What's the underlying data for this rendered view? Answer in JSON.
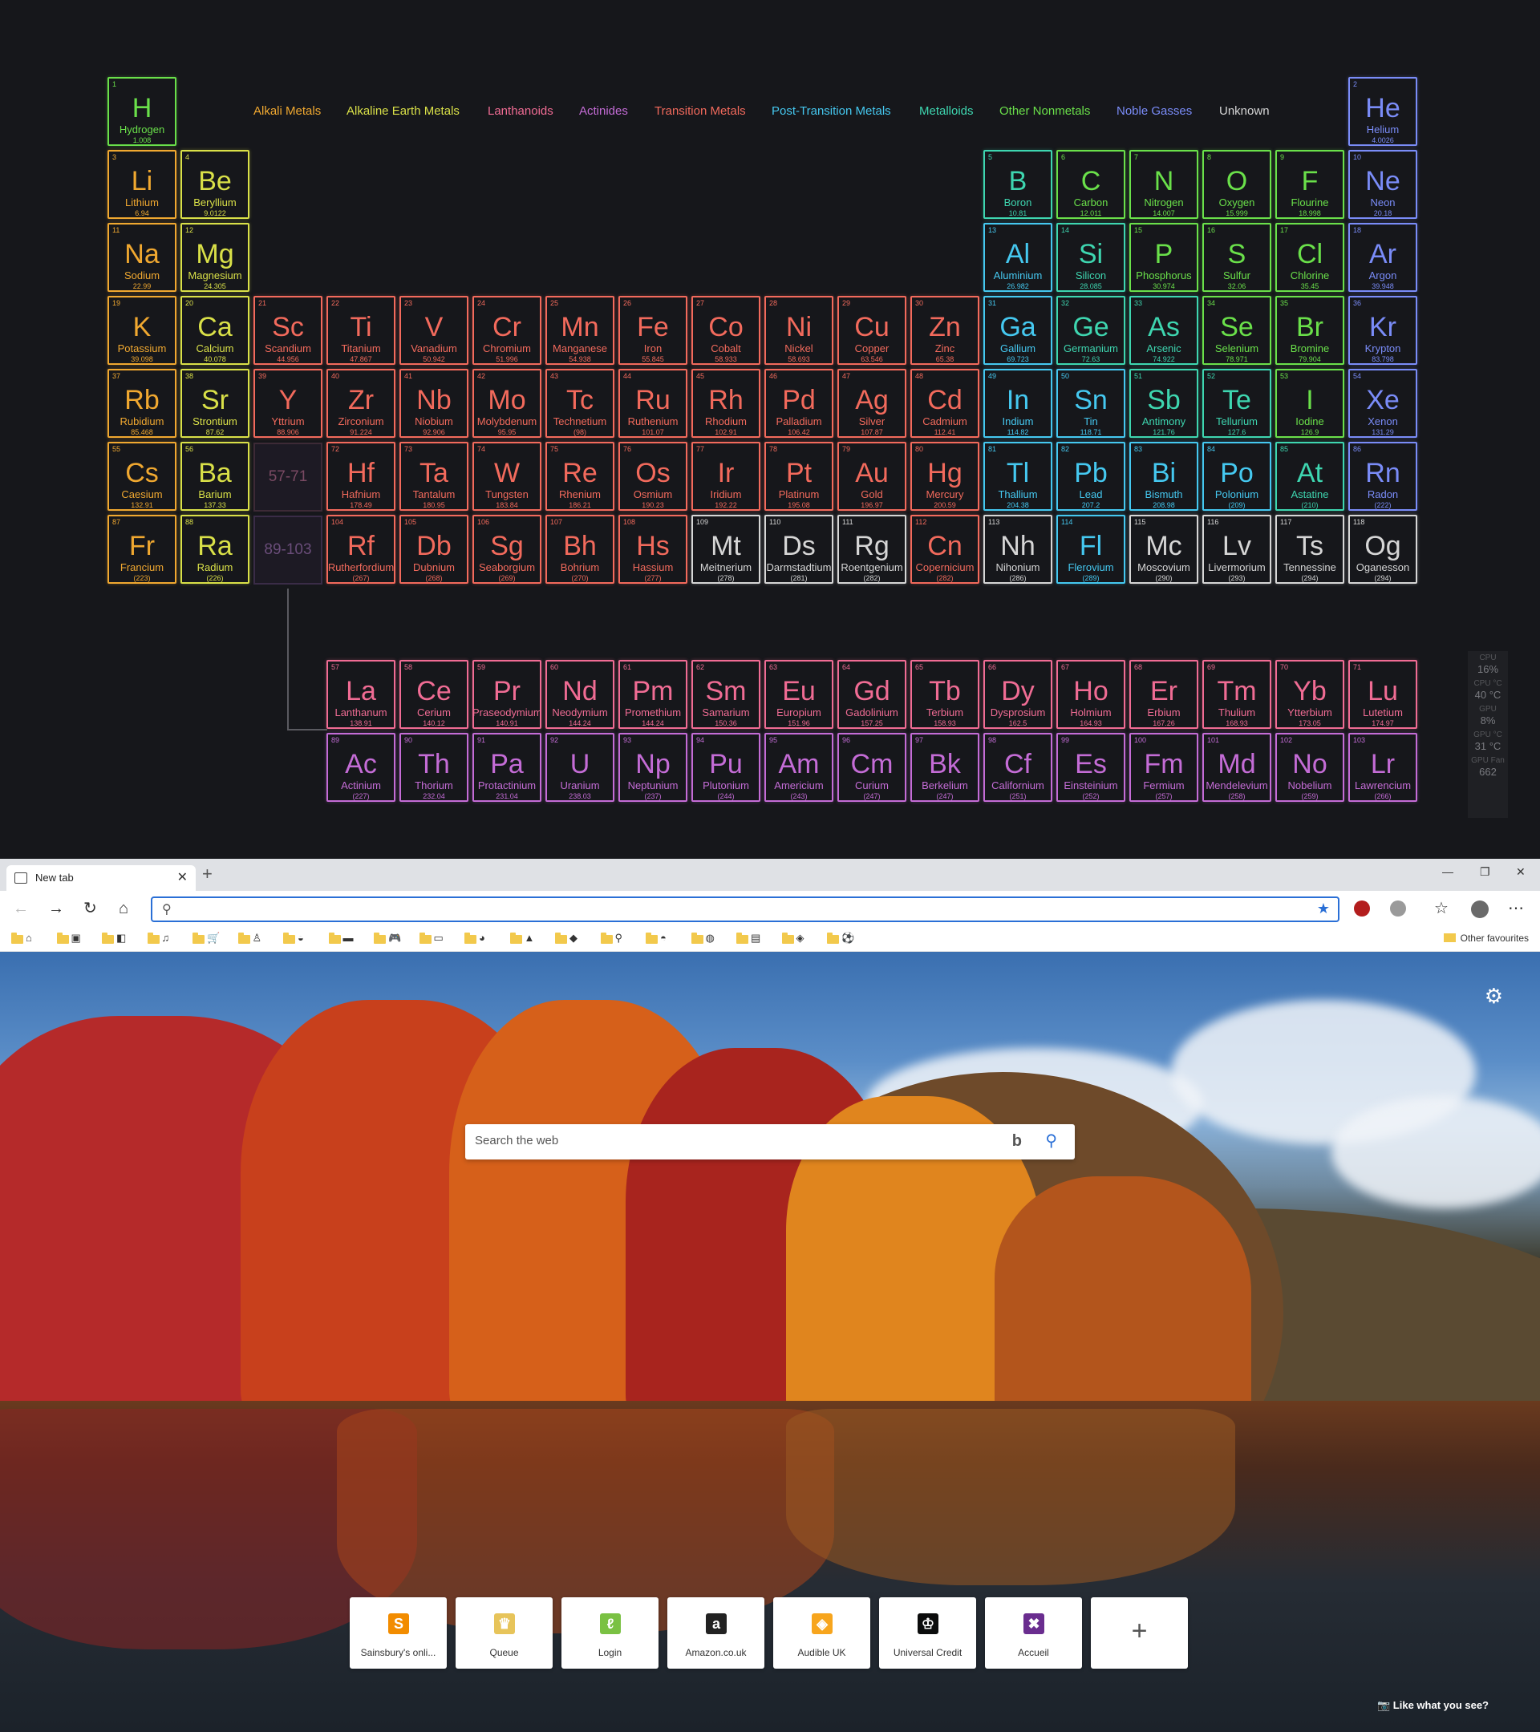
{
  "legend": [
    {
      "label": "Alkali Metals",
      "color": "#f0a830"
    },
    {
      "label": "Alkaline Earth Metals",
      "color": "#d9e048"
    },
    {
      "label": "Lanthanoids",
      "color": "#f06c94"
    },
    {
      "label": "Actinides",
      "color": "#c46cd6"
    },
    {
      "label": "Transition Metals",
      "color": "#f26a5c"
    },
    {
      "label": "Post-Transition Metals",
      "color": "#45c8f0"
    },
    {
      "label": "Metalloids",
      "color": "#3ed6b0"
    },
    {
      "label": "Other Nonmetals",
      "color": "#6ae04a"
    },
    {
      "label": "Noble Gasses",
      "color": "#7a8cf8"
    },
    {
      "label": "Unknown",
      "color": "#d6d6d6"
    }
  ],
  "range_placeholders": {
    "lanthanoids": "57-71",
    "actinides": "89-103"
  },
  "elements": [
    {
      "n": "1",
      "s": "H",
      "name": "Hydrogen",
      "m": "1.008",
      "cat": 7,
      "row": 0,
      "col": 0
    },
    {
      "n": "2",
      "s": "He",
      "name": "Helium",
      "m": "4.0026",
      "cat": 8,
      "row": 0,
      "col": 17
    },
    {
      "n": "3",
      "s": "Li",
      "name": "Lithium",
      "m": "6.94",
      "cat": 0,
      "row": 1,
      "col": 0
    },
    {
      "n": "4",
      "s": "Be",
      "name": "Beryllium",
      "m": "9.0122",
      "cat": 1,
      "row": 1,
      "col": 1
    },
    {
      "n": "5",
      "s": "B",
      "name": "Boron",
      "m": "10.81",
      "cat": 6,
      "row": 1,
      "col": 12
    },
    {
      "n": "6",
      "s": "C",
      "name": "Carbon",
      "m": "12.011",
      "cat": 7,
      "row": 1,
      "col": 13
    },
    {
      "n": "7",
      "s": "N",
      "name": "Nitrogen",
      "m": "14.007",
      "cat": 7,
      "row": 1,
      "col": 14
    },
    {
      "n": "8",
      "s": "O",
      "name": "Oxygen",
      "m": "15.999",
      "cat": 7,
      "row": 1,
      "col": 15
    },
    {
      "n": "9",
      "s": "F",
      "name": "Flourine",
      "m": "18.998",
      "cat": 7,
      "row": 1,
      "col": 16
    },
    {
      "n": "10",
      "s": "Ne",
      "name": "Neon",
      "m": "20.18",
      "cat": 8,
      "row": 1,
      "col": 17
    },
    {
      "n": "11",
      "s": "Na",
      "name": "Sodium",
      "m": "22.99",
      "cat": 0,
      "row": 2,
      "col": 0
    },
    {
      "n": "12",
      "s": "Mg",
      "name": "Magnesium",
      "m": "24.305",
      "cat": 1,
      "row": 2,
      "col": 1
    },
    {
      "n": "13",
      "s": "Al",
      "name": "Aluminium",
      "m": "26.982",
      "cat": 5,
      "row": 2,
      "col": 12
    },
    {
      "n": "14",
      "s": "Si",
      "name": "Silicon",
      "m": "28.085",
      "cat": 6,
      "row": 2,
      "col": 13
    },
    {
      "n": "15",
      "s": "P",
      "name": "Phosphorus",
      "m": "30.974",
      "cat": 7,
      "row": 2,
      "col": 14
    },
    {
      "n": "16",
      "s": "S",
      "name": "Sulfur",
      "m": "32.06",
      "cat": 7,
      "row": 2,
      "col": 15
    },
    {
      "n": "17",
      "s": "Cl",
      "name": "Chlorine",
      "m": "35.45",
      "cat": 7,
      "row": 2,
      "col": 16
    },
    {
      "n": "18",
      "s": "Ar",
      "name": "Argon",
      "m": "39.948",
      "cat": 8,
      "row": 2,
      "col": 17
    },
    {
      "n": "19",
      "s": "K",
      "name": "Potassium",
      "m": "39.098",
      "cat": 0,
      "row": 3,
      "col": 0
    },
    {
      "n": "20",
      "s": "Ca",
      "name": "Calcium",
      "m": "40.078",
      "cat": 1,
      "row": 3,
      "col": 1
    },
    {
      "n": "21",
      "s": "Sc",
      "name": "Scandium",
      "m": "44.956",
      "cat": 4,
      "row": 3,
      "col": 2
    },
    {
      "n": "22",
      "s": "Ti",
      "name": "Titanium",
      "m": "47.867",
      "cat": 4,
      "row": 3,
      "col": 3
    },
    {
      "n": "23",
      "s": "V",
      "name": "Vanadium",
      "m": "50.942",
      "cat": 4,
      "row": 3,
      "col": 4
    },
    {
      "n": "24",
      "s": "Cr",
      "name": "Chromium",
      "m": "51.996",
      "cat": 4,
      "row": 3,
      "col": 5
    },
    {
      "n": "25",
      "s": "Mn",
      "name": "Manganese",
      "m": "54.938",
      "cat": 4,
      "row": 3,
      "col": 6
    },
    {
      "n": "26",
      "s": "Fe",
      "name": "Iron",
      "m": "55.845",
      "cat": 4,
      "row": 3,
      "col": 7
    },
    {
      "n": "27",
      "s": "Co",
      "name": "Cobalt",
      "m": "58.933",
      "cat": 4,
      "row": 3,
      "col": 8
    },
    {
      "n": "28",
      "s": "Ni",
      "name": "Nickel",
      "m": "58.693",
      "cat": 4,
      "row": 3,
      "col": 9
    },
    {
      "n": "29",
      "s": "Cu",
      "name": "Copper",
      "m": "63.546",
      "cat": 4,
      "row": 3,
      "col": 10
    },
    {
      "n": "30",
      "s": "Zn",
      "name": "Zinc",
      "m": "65.38",
      "cat": 4,
      "row": 3,
      "col": 11
    },
    {
      "n": "31",
      "s": "Ga",
      "name": "Gallium",
      "m": "69.723",
      "cat": 5,
      "row": 3,
      "col": 12
    },
    {
      "n": "32",
      "s": "Ge",
      "name": "Germanium",
      "m": "72.63",
      "cat": 6,
      "row": 3,
      "col": 13
    },
    {
      "n": "33",
      "s": "As",
      "name": "Arsenic",
      "m": "74.922",
      "cat": 6,
      "row": 3,
      "col": 14
    },
    {
      "n": "34",
      "s": "Se",
      "name": "Selenium",
      "m": "78.971",
      "cat": 7,
      "row": 3,
      "col": 15
    },
    {
      "n": "35",
      "s": "Br",
      "name": "Bromine",
      "m": "79.904",
      "cat": 7,
      "row": 3,
      "col": 16
    },
    {
      "n": "36",
      "s": "Kr",
      "name": "Krypton",
      "m": "83.798",
      "cat": 8,
      "row": 3,
      "col": 17
    },
    {
      "n": "37",
      "s": "Rb",
      "name": "Rubidium",
      "m": "85.468",
      "cat": 0,
      "row": 4,
      "col": 0
    },
    {
      "n": "38",
      "s": "Sr",
      "name": "Strontium",
      "m": "87.62",
      "cat": 1,
      "row": 4,
      "col": 1
    },
    {
      "n": "39",
      "s": "Y",
      "name": "Yttrium",
      "m": "88.906",
      "cat": 4,
      "row": 4,
      "col": 2
    },
    {
      "n": "40",
      "s": "Zr",
      "name": "Zirconium",
      "m": "91.224",
      "cat": 4,
      "row": 4,
      "col": 3
    },
    {
      "n": "41",
      "s": "Nb",
      "name": "Niobium",
      "m": "92.906",
      "cat": 4,
      "row": 4,
      "col": 4
    },
    {
      "n": "42",
      "s": "Mo",
      "name": "Molybdenum",
      "m": "95.95",
      "cat": 4,
      "row": 4,
      "col": 5
    },
    {
      "n": "43",
      "s": "Tc",
      "name": "Technetium",
      "m": "(98)",
      "cat": 4,
      "row": 4,
      "col": 6
    },
    {
      "n": "44",
      "s": "Ru",
      "name": "Ruthenium",
      "m": "101.07",
      "cat": 4,
      "row": 4,
      "col": 7
    },
    {
      "n": "45",
      "s": "Rh",
      "name": "Rhodium",
      "m": "102.91",
      "cat": 4,
      "row": 4,
      "col": 8
    },
    {
      "n": "46",
      "s": "Pd",
      "name": "Palladium",
      "m": "106.42",
      "cat": 4,
      "row": 4,
      "col": 9
    },
    {
      "n": "47",
      "s": "Ag",
      "name": "Silver",
      "m": "107.87",
      "cat": 4,
      "row": 4,
      "col": 10
    },
    {
      "n": "48",
      "s": "Cd",
      "name": "Cadmium",
      "m": "112.41",
      "cat": 4,
      "row": 4,
      "col": 11
    },
    {
      "n": "49",
      "s": "In",
      "name": "Indium",
      "m": "114.82",
      "cat": 5,
      "row": 4,
      "col": 12
    },
    {
      "n": "50",
      "s": "Sn",
      "name": "Tin",
      "m": "118.71",
      "cat": 5,
      "row": 4,
      "col": 13
    },
    {
      "n": "51",
      "s": "Sb",
      "name": "Antimony",
      "m": "121.76",
      "cat": 6,
      "row": 4,
      "col": 14
    },
    {
      "n": "52",
      "s": "Te",
      "name": "Tellurium",
      "m": "127.6",
      "cat": 6,
      "row": 4,
      "col": 15
    },
    {
      "n": "53",
      "s": "I",
      "name": "Iodine",
      "m": "126.9",
      "cat": 7,
      "row": 4,
      "col": 16
    },
    {
      "n": "54",
      "s": "Xe",
      "name": "Xenon",
      "m": "131.29",
      "cat": 8,
      "row": 4,
      "col": 17
    },
    {
      "n": "55",
      "s": "Cs",
      "name": "Caesium",
      "m": "132.91",
      "cat": 0,
      "row": 5,
      "col": 0
    },
    {
      "n": "56",
      "s": "Ba",
      "name": "Barium",
      "m": "137.33",
      "cat": 1,
      "row": 5,
      "col": 1
    },
    {
      "n": "72",
      "s": "Hf",
      "name": "Hafnium",
      "m": "178.49",
      "cat": 4,
      "row": 5,
      "col": 3
    },
    {
      "n": "73",
      "s": "Ta",
      "name": "Tantalum",
      "m": "180.95",
      "cat": 4,
      "row": 5,
      "col": 4
    },
    {
      "n": "74",
      "s": "W",
      "name": "Tungsten",
      "m": "183.84",
      "cat": 4,
      "row": 5,
      "col": 5
    },
    {
      "n": "75",
      "s": "Re",
      "name": "Rhenium",
      "m": "186.21",
      "cat": 4,
      "row": 5,
      "col": 6
    },
    {
      "n": "76",
      "s": "Os",
      "name": "Osmium",
      "m": "190.23",
      "cat": 4,
      "row": 5,
      "col": 7
    },
    {
      "n": "77",
      "s": "Ir",
      "name": "Iridium",
      "m": "192.22",
      "cat": 4,
      "row": 5,
      "col": 8
    },
    {
      "n": "78",
      "s": "Pt",
      "name": "Platinum",
      "m": "195.08",
      "cat": 4,
      "row": 5,
      "col": 9
    },
    {
      "n": "79",
      "s": "Au",
      "name": "Gold",
      "m": "196.97",
      "cat": 4,
      "row": 5,
      "col": 10
    },
    {
      "n": "80",
      "s": "Hg",
      "name": "Mercury",
      "m": "200.59",
      "cat": 4,
      "row": 5,
      "col": 11
    },
    {
      "n": "81",
      "s": "Tl",
      "name": "Thallium",
      "m": "204.38",
      "cat": 5,
      "row": 5,
      "col": 12
    },
    {
      "n": "82",
      "s": "Pb",
      "name": "Lead",
      "m": "207.2",
      "cat": 5,
      "row": 5,
      "col": 13
    },
    {
      "n": "83",
      "s": "Bi",
      "name": "Bismuth",
      "m": "208.98",
      "cat": 5,
      "row": 5,
      "col": 14
    },
    {
      "n": "84",
      "s": "Po",
      "name": "Polonium",
      "m": "(209)",
      "cat": 5,
      "row": 5,
      "col": 15
    },
    {
      "n": "85",
      "s": "At",
      "name": "Astatine",
      "m": "(210)",
      "cat": 6,
      "row": 5,
      "col": 16
    },
    {
      "n": "86",
      "s": "Rn",
      "name": "Radon",
      "m": "(222)",
      "cat": 8,
      "row": 5,
      "col": 17
    },
    {
      "n": "87",
      "s": "Fr",
      "name": "Francium",
      "m": "(223)",
      "cat": 0,
      "row": 6,
      "col": 0
    },
    {
      "n": "88",
      "s": "Ra",
      "name": "Radium",
      "m": "(226)",
      "cat": 1,
      "row": 6,
      "col": 1
    },
    {
      "n": "104",
      "s": "Rf",
      "name": "Rutherfordium",
      "m": "(267)",
      "cat": 4,
      "row": 6,
      "col": 3
    },
    {
      "n": "105",
      "s": "Db",
      "name": "Dubnium",
      "m": "(268)",
      "cat": 4,
      "row": 6,
      "col": 4
    },
    {
      "n": "106",
      "s": "Sg",
      "name": "Seaborgium",
      "m": "(269)",
      "cat": 4,
      "row": 6,
      "col": 5
    },
    {
      "n": "107",
      "s": "Bh",
      "name": "Bohrium",
      "m": "(270)",
      "cat": 4,
      "row": 6,
      "col": 6
    },
    {
      "n": "108",
      "s": "Hs",
      "name": "Hassium",
      "m": "(277)",
      "cat": 4,
      "row": 6,
      "col": 7
    },
    {
      "n": "109",
      "s": "Mt",
      "name": "Meitnerium",
      "m": "(278)",
      "cat": 9,
      "row": 6,
      "col": 8
    },
    {
      "n": "110",
      "s": "Ds",
      "name": "Darmstadtium",
      "m": "(281)",
      "cat": 9,
      "row": 6,
      "col": 9
    },
    {
      "n": "111",
      "s": "Rg",
      "name": "Roentgenium",
      "m": "(282)",
      "cat": 9,
      "row": 6,
      "col": 10
    },
    {
      "n": "112",
      "s": "Cn",
      "name": "Copernicium",
      "m": "(282)",
      "cat": 4,
      "row": 6,
      "col": 11
    },
    {
      "n": "113",
      "s": "Nh",
      "name": "Nihonium",
      "m": "(286)",
      "cat": 9,
      "row": 6,
      "col": 12
    },
    {
      "n": "114",
      "s": "Fl",
      "name": "Flerovium",
      "m": "(289)",
      "cat": 5,
      "row": 6,
      "col": 13
    },
    {
      "n": "115",
      "s": "Mc",
      "name": "Moscovium",
      "m": "(290)",
      "cat": 9,
      "row": 6,
      "col": 14
    },
    {
      "n": "116",
      "s": "Lv",
      "name": "Livermorium",
      "m": "(293)",
      "cat": 9,
      "row": 6,
      "col": 15
    },
    {
      "n": "117",
      "s": "Ts",
      "name": "Tennessine",
      "m": "(294)",
      "cat": 9,
      "row": 6,
      "col": 16
    },
    {
      "n": "118",
      "s": "Og",
      "name": "Oganesson",
      "m": "(294)",
      "cat": 9,
      "row": 6,
      "col": 17
    },
    {
      "n": "57",
      "s": "La",
      "name": "Lanthanum",
      "m": "138.91",
      "cat": 2,
      "row": 7,
      "col": 3
    },
    {
      "n": "58",
      "s": "Ce",
      "name": "Cerium",
      "m": "140.12",
      "cat": 2,
      "row": 7,
      "col": 4
    },
    {
      "n": "59",
      "s": "Pr",
      "name": "Praseodymium",
      "m": "140.91",
      "cat": 2,
      "row": 7,
      "col": 5
    },
    {
      "n": "60",
      "s": "Nd",
      "name": "Neodymium",
      "m": "144.24",
      "cat": 2,
      "row": 7,
      "col": 6
    },
    {
      "n": "61",
      "s": "Pm",
      "name": "Promethium",
      "m": "144.24",
      "cat": 2,
      "row": 7,
      "col": 7
    },
    {
      "n": "62",
      "s": "Sm",
      "name": "Samarium",
      "m": "150.36",
      "cat": 2,
      "row": 7,
      "col": 8
    },
    {
      "n": "63",
      "s": "Eu",
      "name": "Europium",
      "m": "151.96",
      "cat": 2,
      "row": 7,
      "col": 9
    },
    {
      "n": "64",
      "s": "Gd",
      "name": "Gadolinium",
      "m": "157.25",
      "cat": 2,
      "row": 7,
      "col": 10
    },
    {
      "n": "65",
      "s": "Tb",
      "name": "Terbium",
      "m": "158.93",
      "cat": 2,
      "row": 7,
      "col": 11
    },
    {
      "n": "66",
      "s": "Dy",
      "name": "Dysprosium",
      "m": "162.5",
      "cat": 2,
      "row": 7,
      "col": 12
    },
    {
      "n": "67",
      "s": "Ho",
      "name": "Holmium",
      "m": "164.93",
      "cat": 2,
      "row": 7,
      "col": 13
    },
    {
      "n": "68",
      "s": "Er",
      "name": "Erbium",
      "m": "167.26",
      "cat": 2,
      "row": 7,
      "col": 14
    },
    {
      "n": "69",
      "s": "Tm",
      "name": "Thulium",
      "m": "168.93",
      "cat": 2,
      "row": 7,
      "col": 15
    },
    {
      "n": "70",
      "s": "Yb",
      "name": "Ytterbium",
      "m": "173.05",
      "cat": 2,
      "row": 7,
      "col": 16
    },
    {
      "n": "71",
      "s": "Lu",
      "name": "Lutetium",
      "m": "174.97",
      "cat": 2,
      "row": 7,
      "col": 17
    },
    {
      "n": "89",
      "s": "Ac",
      "name": "Actinium",
      "m": "(227)",
      "cat": 3,
      "row": 8,
      "col": 3
    },
    {
      "n": "90",
      "s": "Th",
      "name": "Thorium",
      "m": "232.04",
      "cat": 3,
      "row": 8,
      "col": 4
    },
    {
      "n": "91",
      "s": "Pa",
      "name": "Protactinium",
      "m": "231.04",
      "cat": 3,
      "row": 8,
      "col": 5
    },
    {
      "n": "92",
      "s": "U",
      "name": "Uranium",
      "m": "238.03",
      "cat": 3,
      "row": 8,
      "col": 6
    },
    {
      "n": "93",
      "s": "Np",
      "name": "Neptunium",
      "m": "(237)",
      "cat": 3,
      "row": 8,
      "col": 7
    },
    {
      "n": "94",
      "s": "Pu",
      "name": "Plutonium",
      "m": "(244)",
      "cat": 3,
      "row": 8,
      "col": 8
    },
    {
      "n": "95",
      "s": "Am",
      "name": "Americium",
      "m": "(243)",
      "cat": 3,
      "row": 8,
      "col": 9
    },
    {
      "n": "96",
      "s": "Cm",
      "name": "Curium",
      "m": "(247)",
      "cat": 3,
      "row": 8,
      "col": 10
    },
    {
      "n": "97",
      "s": "Bk",
      "name": "Berkelium",
      "m": "(247)",
      "cat": 3,
      "row": 8,
      "col": 11
    },
    {
      "n": "98",
      "s": "Cf",
      "name": "Californium",
      "m": "(251)",
      "cat": 3,
      "row": 8,
      "col": 12
    },
    {
      "n": "99",
      "s": "Es",
      "name": "Einsteinium",
      "m": "(252)",
      "cat": 3,
      "row": 8,
      "col": 13
    },
    {
      "n": "100",
      "s": "Fm",
      "name": "Fermium",
      "m": "(257)",
      "cat": 3,
      "row": 8,
      "col": 14
    },
    {
      "n": "101",
      "s": "Md",
      "name": "Mendelevium",
      "m": "(258)",
      "cat": 3,
      "row": 8,
      "col": 15
    },
    {
      "n": "102",
      "s": "No",
      "name": "Nobelium",
      "m": "(259)",
      "cat": 3,
      "row": 8,
      "col": 16
    },
    {
      "n": "103",
      "s": "Lr",
      "name": "Lawrencium",
      "m": "(266)",
      "cat": 3,
      "row": 8,
      "col": 17
    }
  ],
  "hw_monitor": [
    {
      "label": "CPU",
      "value": "16%"
    },
    {
      "label": "CPU °C",
      "value": "40 °C"
    },
    {
      "label": "GPU",
      "value": "8%"
    },
    {
      "label": "GPU °C",
      "value": "31 °C"
    },
    {
      "label": "GPU Fan",
      "value": "662"
    }
  ],
  "browser": {
    "tab_title": "New tab",
    "tab_close": "✕",
    "new_tab": "+",
    "window_controls": {
      "minimize": "—",
      "restore": "❐",
      "close": "✕"
    },
    "address_value": "",
    "favorites": [
      {
        "icon": "⌂"
      },
      {
        "icon": "▣"
      },
      {
        "icon": "◧"
      },
      {
        "icon": "♫"
      },
      {
        "icon": "🛒"
      },
      {
        "icon": "♙"
      },
      {
        "icon": "◒"
      },
      {
        "icon": "▬"
      },
      {
        "icon": "🎮"
      },
      {
        "icon": "▭"
      },
      {
        "icon": "◕"
      },
      {
        "icon": "▲"
      },
      {
        "icon": "◆"
      },
      {
        "icon": "⚲"
      },
      {
        "icon": "◓"
      },
      {
        "icon": "◍"
      },
      {
        "icon": "▤"
      },
      {
        "icon": "◈"
      },
      {
        "icon": "⚽"
      }
    ],
    "other_favourites": "Other favourites",
    "search_placeholder": "Search the web",
    "bing_logo": "b",
    "tiles": [
      {
        "label": "Sainsbury's onli...",
        "icon": "S",
        "color": "#f28c00"
      },
      {
        "label": "Queue",
        "icon": "♛",
        "color": "#e7c45a"
      },
      {
        "label": "Login",
        "icon": "ℓ",
        "color": "#7ac143"
      },
      {
        "label": "Amazon.co.uk",
        "icon": "a",
        "color": "#222222"
      },
      {
        "label": "Audible UK",
        "icon": "◈",
        "color": "#f7a51d"
      },
      {
        "label": "Universal Credit",
        "icon": "♔",
        "color": "#0b0c0c"
      },
      {
        "label": "Accueil",
        "icon": "✖",
        "color": "#6a2d8f"
      }
    ],
    "like_text": "Like what you see?"
  }
}
